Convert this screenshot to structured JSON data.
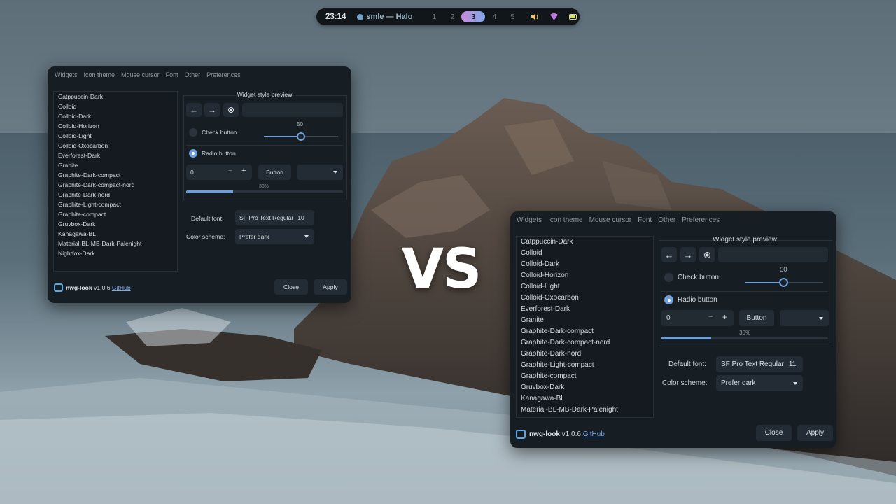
{
  "topbar": {
    "time": "23:14",
    "window_title": "smle — Halo",
    "workspaces": [
      "1",
      "2",
      "3",
      "4",
      "5"
    ],
    "active_workspace": "3",
    "icons": [
      "volume-icon",
      "wifi-icon",
      "battery-icon"
    ]
  },
  "overlay_text": "VS",
  "windows": [
    {
      "tabs": [
        "Widgets",
        "Icon theme",
        "Mouse cursor",
        "Font",
        "Other",
        "Preferences"
      ],
      "themes": [
        "Catppuccin-Dark",
        "Colloid",
        "Colloid-Dark",
        "Colloid-Horizon",
        "Colloid-Light",
        "Colloid-Oxocarbon",
        "Everforest-Dark",
        "Granite",
        "Graphite-Dark-compact",
        "Graphite-Dark-compact-nord",
        "Graphite-Dark-nord",
        "Graphite-Light-compact",
        "Graphite-compact",
        "Gruvbox-Dark",
        "Kanagawa-BL",
        "Material-BL-MB-Dark-Palenight",
        "Nightfox-Dark"
      ],
      "preview": {
        "title": "Widget style preview",
        "check_label": "Check button",
        "radio_label": "Radio button",
        "slider_value": "50",
        "spin_value": "0",
        "spin_minus": "−",
        "spin_plus": "+",
        "button_label": "Button",
        "progress_label": "30%",
        "progress_fraction": 0.3,
        "slider_fraction": 0.5
      },
      "default_font_label": "Default font:",
      "default_font_value": "SF Pro Text Regular",
      "default_font_size": "10",
      "color_scheme_label": "Color scheme:",
      "color_scheme_value": "Prefer dark",
      "app_name": "nwg-look",
      "version": "v1.0.6",
      "link": "GitHub",
      "close_label": "Close",
      "apply_label": "Apply"
    },
    {
      "tabs": [
        "Widgets",
        "Icon theme",
        "Mouse cursor",
        "Font",
        "Other",
        "Preferences"
      ],
      "themes": [
        "Catppuccin-Dark",
        "Colloid",
        "Colloid-Dark",
        "Colloid-Horizon",
        "Colloid-Light",
        "Colloid-Oxocarbon",
        "Everforest-Dark",
        "Granite",
        "Graphite-Dark-compact",
        "Graphite-Dark-compact-nord",
        "Graphite-Dark-nord",
        "Graphite-Light-compact",
        "Graphite-compact",
        "Gruvbox-Dark",
        "Kanagawa-BL",
        "Material-BL-MB-Dark-Palenight"
      ],
      "preview": {
        "title": "Widget style preview",
        "check_label": "Check button",
        "radio_label": "Radio button",
        "slider_value": "50",
        "spin_value": "0",
        "spin_minus": "−",
        "spin_plus": "+",
        "button_label": "Button",
        "progress_label": "30%",
        "progress_fraction": 0.3,
        "slider_fraction": 0.5
      },
      "default_font_label": "Default font:",
      "default_font_value": "SF Pro Text Regular",
      "default_font_size": "11",
      "color_scheme_label": "Color scheme:",
      "color_scheme_value": "Prefer dark",
      "app_name": "nwg-look",
      "version": "v1.0.6",
      "link": "GitHub",
      "close_label": "Close",
      "apply_label": "Apply"
    }
  ],
  "colors": {
    "accent": "#6f9fd6",
    "window_bg": "#161d23",
    "workspace_active_gradient": [
      "#c78ad8",
      "#7fa8e8"
    ]
  }
}
